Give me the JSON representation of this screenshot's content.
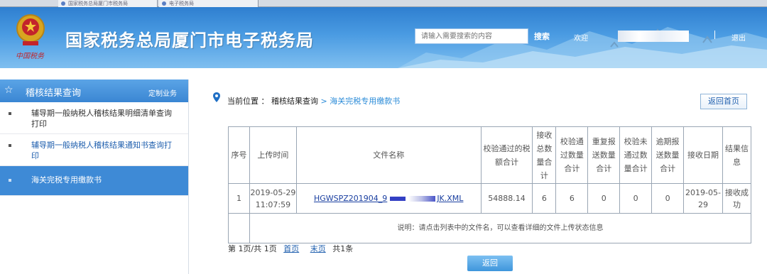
{
  "browser": {
    "tabs": [
      "国家税务总局厦门市税务局",
      "电子税务局"
    ]
  },
  "header": {
    "site_title": "国家税务总局厦门市电子税务局",
    "brand_signature": "中国税务",
    "search_placeholder": "请输入需要搜索的内容",
    "search_button": "搜索",
    "welcome": "欢迎",
    "divider": "|",
    "logout": "退出"
  },
  "sidebar": {
    "header_title": "稽核结果查询",
    "header_link": "定制业务",
    "items": [
      {
        "label": "辅导期一般纳税人稽核结果明细清单查询打印"
      },
      {
        "label": "辅导期一般纳税人稽核结果通知书查询打印"
      },
      {
        "label": "海关完税专用缴款书"
      }
    ]
  },
  "main": {
    "location_label": "当前位置 ：",
    "crumb_parent": "稽核结果查询",
    "crumb_sep": ">",
    "crumb_current": "海关完税专用缴款书",
    "home_button": "返回首页",
    "table": {
      "headers": [
        "序号",
        "上传时间",
        "文件名称",
        "校验通过的税额合计",
        "接收总数量合计",
        "校验通过数量合计",
        "重复报送数量合计",
        "校验未通过数量合计",
        "逾期报送数量合计",
        "接收日期",
        "结果信息"
      ],
      "rows": [
        {
          "index": "1",
          "upload_time": "2019-05-29 11:07:59",
          "file_name_prefix": "HGWSPZ201904_9",
          "file_name_suffix": "JK.XML",
          "tax_total": "54888.14",
          "received": "6",
          "passed": "6",
          "duplicate": "0",
          "failed": "0",
          "overdue": "0",
          "receive_date": "2019-05-29",
          "result": "接收成功"
        }
      ],
      "note": "说明：请点击列表中的文件名，可以查看详细的文件上传状态信息"
    },
    "pager": {
      "page_info": "第 1页/共 1页",
      "first": "首页",
      "last": "末页",
      "total": "共1条"
    },
    "back_button": "返回"
  },
  "colors": {
    "header_blue": "#2f7fd0",
    "sidebar_active": "#3e8ad6",
    "link": "#1f5fae",
    "crumb": "#2a8bd8"
  }
}
